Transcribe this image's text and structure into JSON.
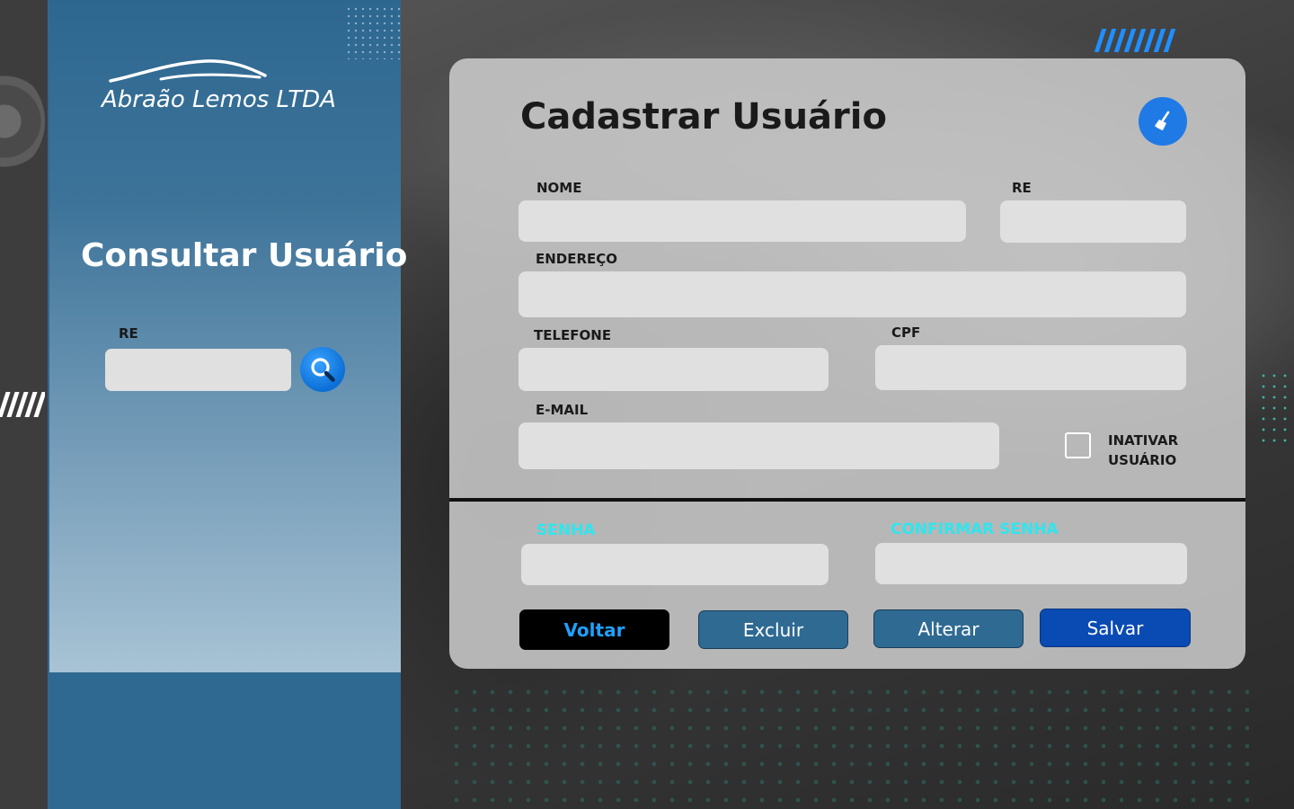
{
  "brand": {
    "name": "Abraão Lemos LTDA"
  },
  "sidebar": {
    "title": "Consultar Usuário",
    "re_label": "RE",
    "re_value": ""
  },
  "form": {
    "title": "Cadastrar Usuário",
    "fields": {
      "nome": {
        "label": "NOME",
        "value": ""
      },
      "re": {
        "label": "RE",
        "value": ""
      },
      "endereco": {
        "label": "ENDEREÇO",
        "value": ""
      },
      "telefone": {
        "label": "TELEFONE",
        "value": ""
      },
      "cpf": {
        "label": "CPF",
        "value": ""
      },
      "email": {
        "label": "E-MAIL",
        "value": ""
      },
      "senha": {
        "label": "SENHA",
        "value": ""
      },
      "confirmar_senha": {
        "label": "CONFIRMAR SENHA",
        "value": ""
      }
    },
    "inactivate": {
      "label": "INATIVAR USUÁRIO",
      "checked": false
    },
    "buttons": {
      "voltar": "Voltar",
      "excluir": "Excluir",
      "alterar": "Alterar",
      "salvar": "Salvar"
    }
  },
  "icons": {
    "search": "search-icon",
    "clear": "broom-icon",
    "logo": "car-silhouette-icon"
  },
  "colors": {
    "sidebar": "#2f6890",
    "accent_blue": "#1f7ae6",
    "cyan_label": "#2fe6ef",
    "save_button": "#0a4bb3"
  }
}
